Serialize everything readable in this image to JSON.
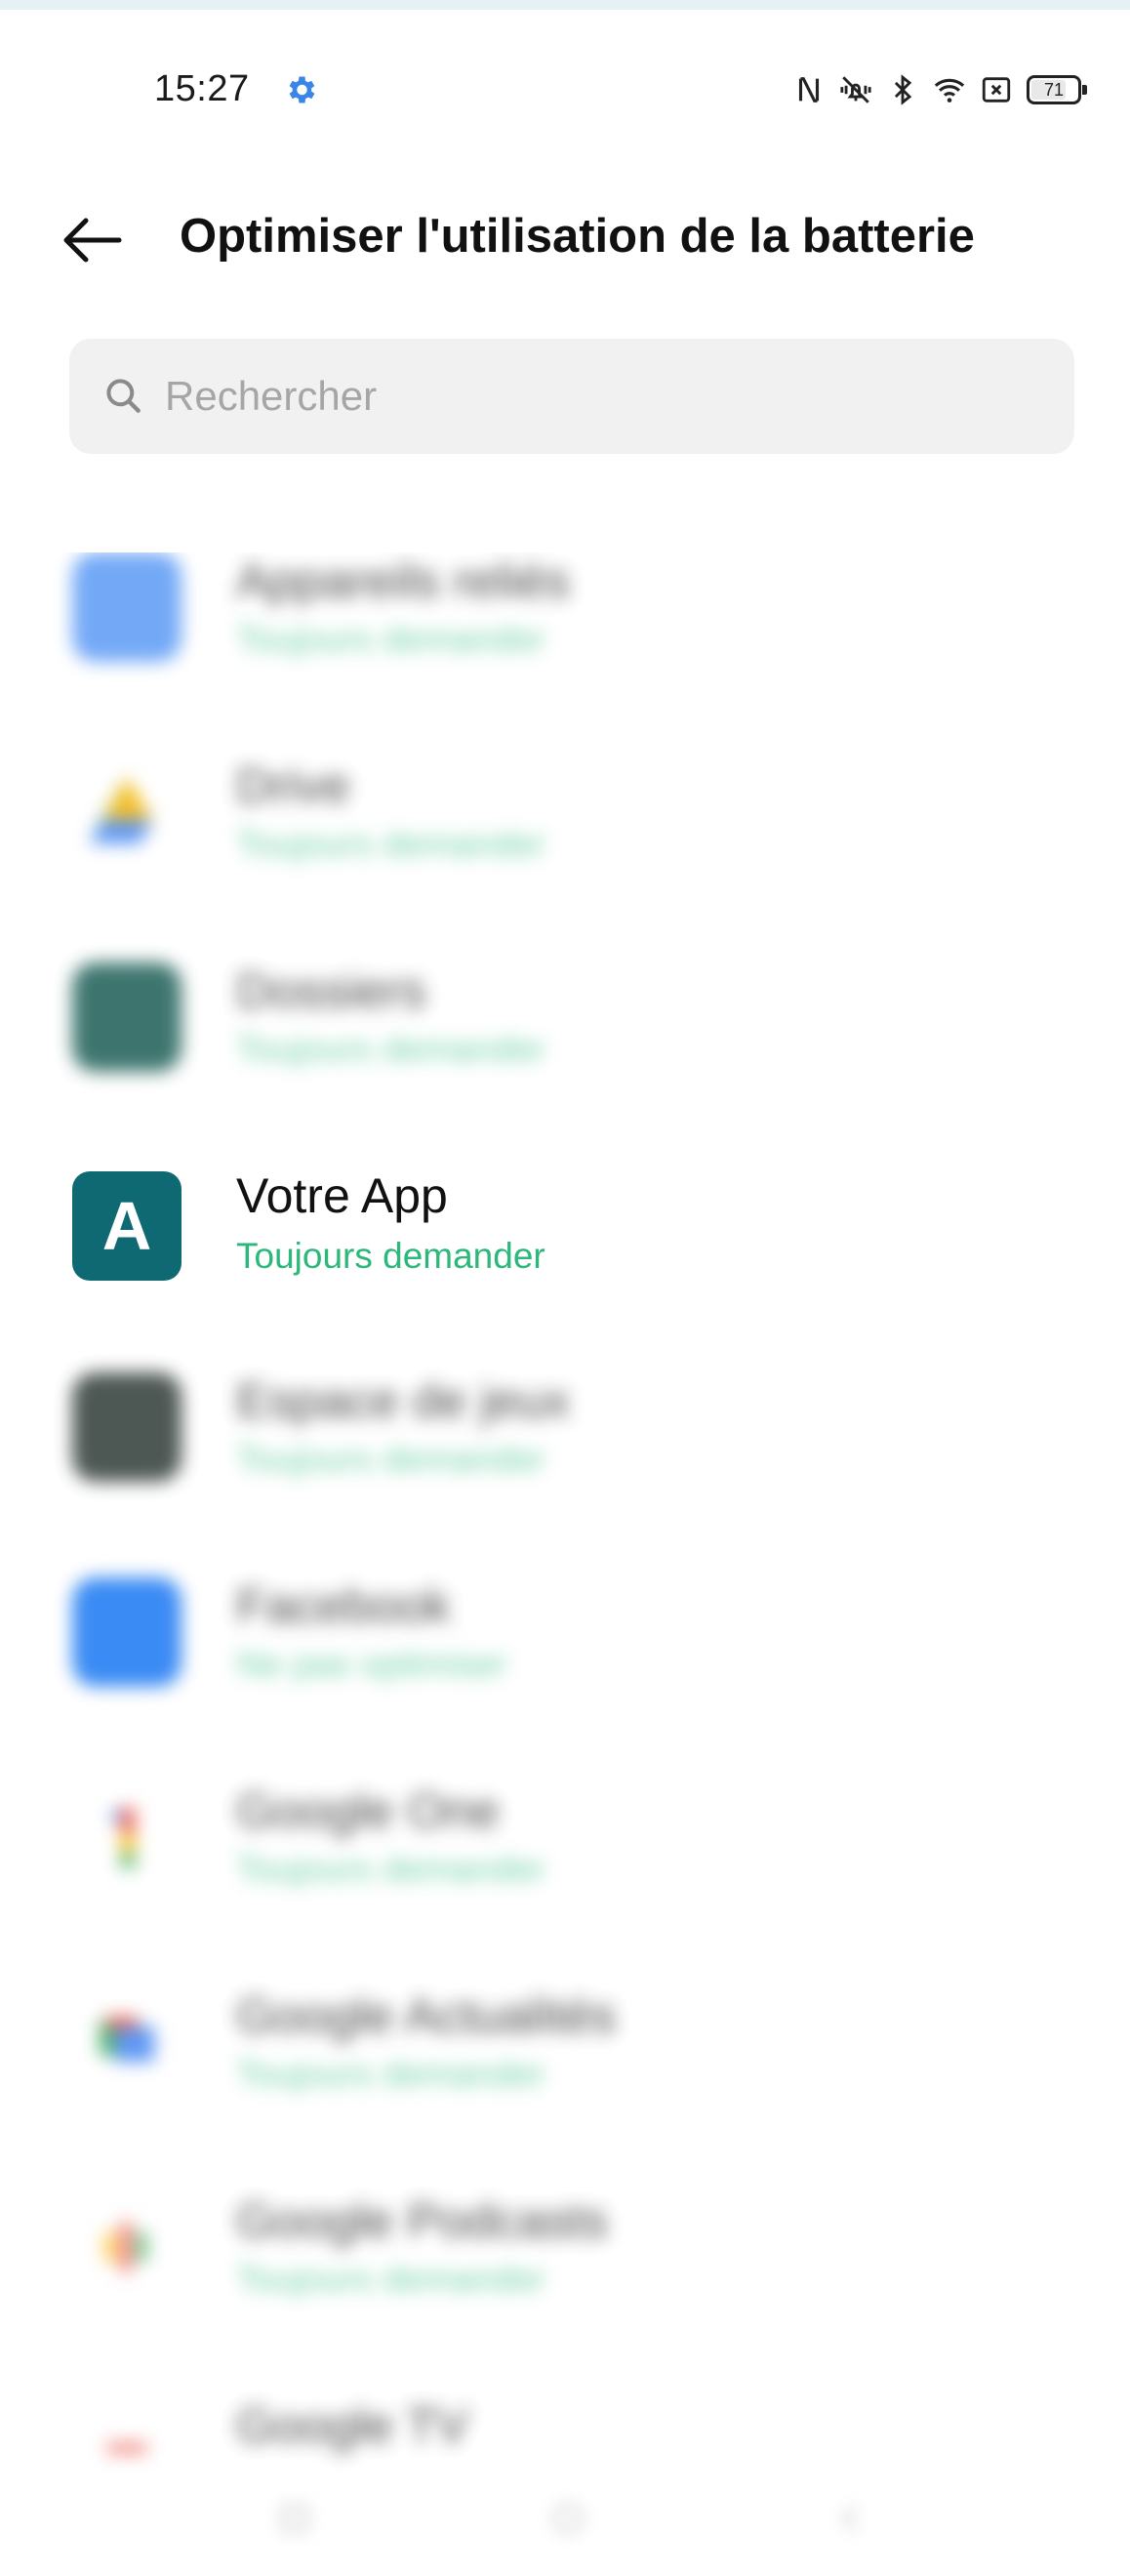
{
  "status_bar": {
    "time": "15:27",
    "battery": "71",
    "icons": [
      "settings-gear-icon",
      "nfc-icon",
      "vibrate-icon",
      "bluetooth-icon",
      "wifi-icon",
      "sim-off-icon",
      "battery-icon"
    ]
  },
  "header": {
    "title": "Optimiser l'utilisation de la batterie",
    "back_icon": "arrow-left-icon"
  },
  "search": {
    "placeholder": "Rechercher",
    "value": ""
  },
  "colors": {
    "status_green": "#2cb87a",
    "accent_blue": "#3a86e8",
    "votre_app_icon": "#0f6973"
  },
  "apps": [
    {
      "name": "Appareils reliés",
      "status": "Toujours demander",
      "icon": "app-icon"
    },
    {
      "name": "Drive",
      "status": "Toujours demander",
      "icon": "app-icon"
    },
    {
      "name": "Dossiers",
      "status": "Toujours demander",
      "icon": "app-icon"
    },
    {
      "name": "Votre App",
      "status": "Toujours demander",
      "icon": "app-icon",
      "icon_letter": "A"
    },
    {
      "name": "Espace de jeux",
      "status": "Toujours demander",
      "icon": "app-icon"
    },
    {
      "name": "Facebook",
      "status": "Ne pas optimiser",
      "icon": "app-icon"
    },
    {
      "name": "Google One",
      "status": "Toujours demander",
      "icon": "app-icon"
    },
    {
      "name": "Google Actualités",
      "status": "Toujours demander",
      "icon": "app-icon"
    },
    {
      "name": "Google Podcasts",
      "status": "Toujours demander",
      "icon": "app-icon"
    },
    {
      "name": "Google TV",
      "status": "",
      "icon": "app-icon"
    }
  ],
  "nav_bar": [
    "nav-back-icon",
    "nav-home-icon",
    "nav-recents-icon"
  ]
}
